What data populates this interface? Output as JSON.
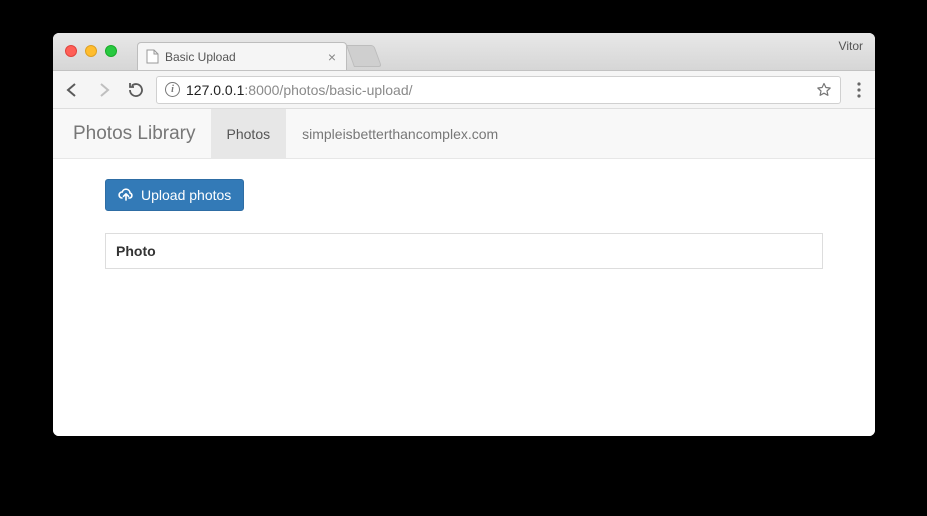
{
  "browser": {
    "profile_name": "Vitor",
    "tab_title": "Basic Upload",
    "url_host": "127.0.0.1",
    "url_path": ":8000/photos/basic-upload/"
  },
  "nav": {
    "brand": "Photos Library",
    "items": [
      {
        "label": "Photos",
        "active": true
      },
      {
        "label": "simpleisbetterthancomplex.com",
        "active": false
      }
    ]
  },
  "page": {
    "upload_button_label": "Upload photos",
    "table_headers": [
      "Photo"
    ]
  }
}
